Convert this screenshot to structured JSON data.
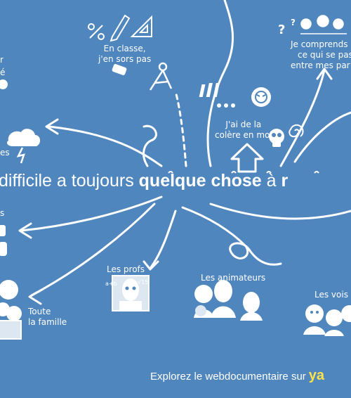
{
  "colors": {
    "background": "#4f86bd",
    "line": "#ffffff",
    "figure_fill": "#dce7f2",
    "brand": "#ffe24a"
  },
  "headline": {
    "pre": "difficile a toujours",
    "bold": "quelque chose",
    "post": "à",
    "cut": "r"
  },
  "footer": {
    "text": "Explorez le webdocumentaire sur",
    "brand": "ya"
  },
  "labels": {
    "classe_1": "En classe,",
    "classe_2": "j'en sors pas",
    "comprends_1": "Je comprends",
    "comprends_2": "ce qui se pas",
    "comprends_3": "entre mes par",
    "colere_1": "J'ai de la",
    "colere_2": "colère en moi",
    "profs": "Les profs",
    "animateurs": "Les animateurs",
    "voisins": "Les vois",
    "famille_1": "Toute",
    "famille_2": "la famille",
    "edge_r": "r",
    "edge_e": "é",
    "edge_es": "es",
    "edge_s": "s"
  },
  "icons": [
    "percent-icon",
    "pencil-icon",
    "ruler-triangle-icon",
    "eraser-icon",
    "compass-icon",
    "question-marks-icon",
    "exclamation-marks-icon",
    "angry-face-icon",
    "skull-icon",
    "spiral-icon",
    "storm-cloud-icon",
    "teacher-figure-icon",
    "animators-figures-icon",
    "neighbors-figures-icon",
    "family-figures-icon",
    "arrow-up-icon"
  ]
}
